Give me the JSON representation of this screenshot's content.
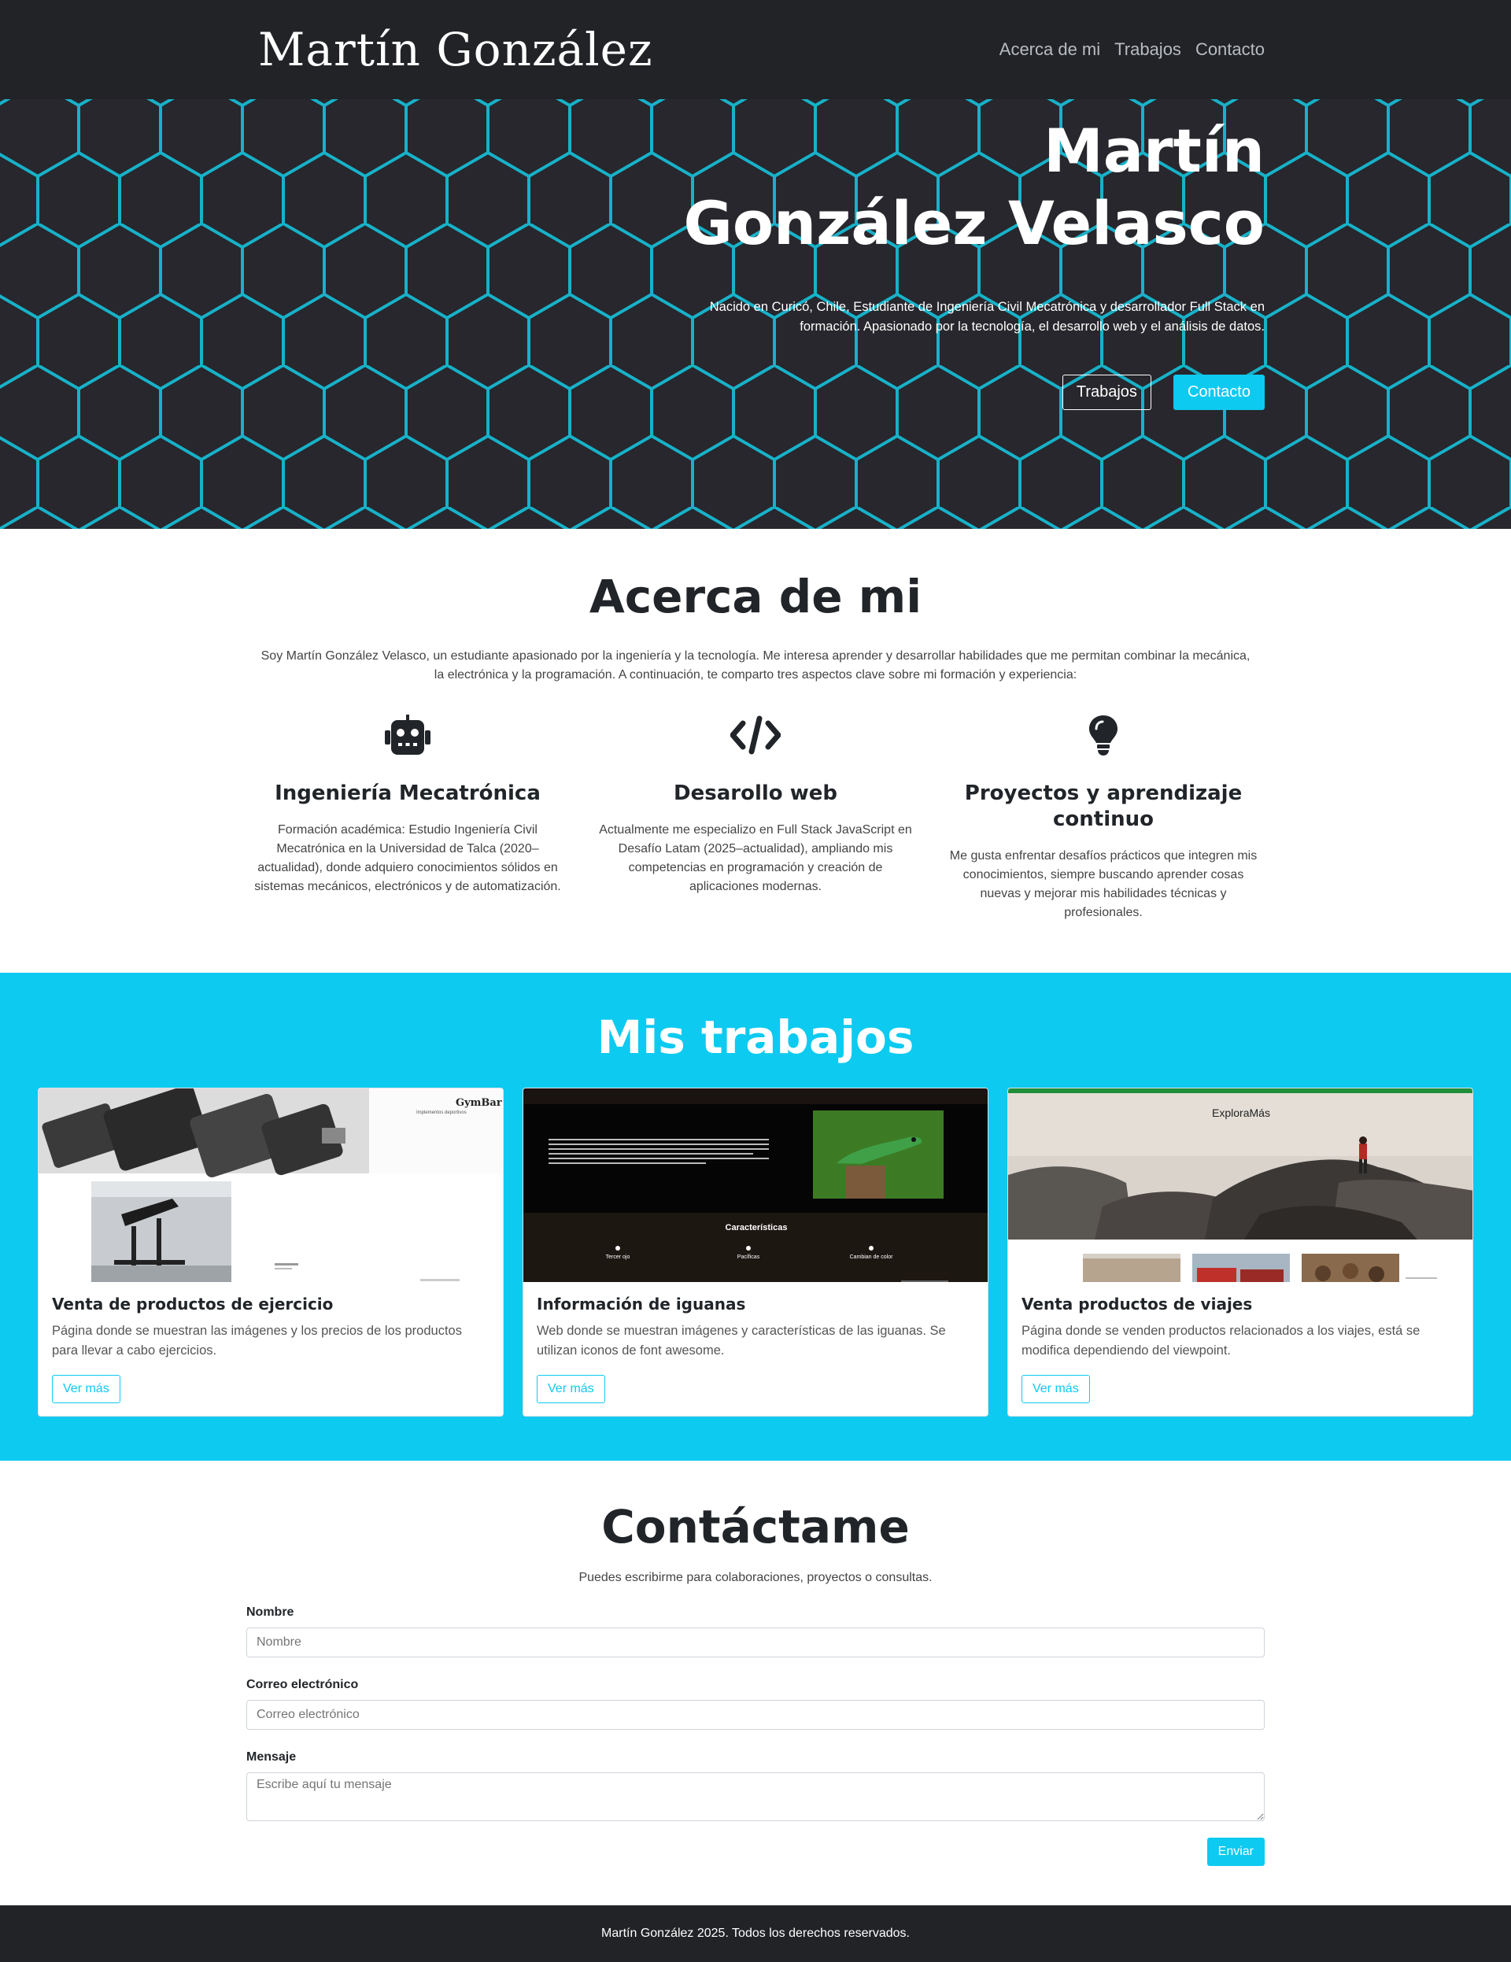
{
  "navbar": {
    "brand": "Martín  González",
    "links": [
      "Acerca de mi",
      "Trabajos",
      "Contacto"
    ]
  },
  "hero": {
    "title_line1": "Martín",
    "title_line2": "González Velasco",
    "description_line1": "Nacido en Curicó, Chile, Estudiante de Ingeniería Civil Mecatrónica y desarrollador Full Stack en",
    "description_line2": "formación. Apasionado por la tecnología, el desarrollo web y el análisis de datos.",
    "btn_works": "Trabajos",
    "btn_contact": "Contacto"
  },
  "about": {
    "title": "Acerca de mi",
    "intro_line1": "Soy Martín González Velasco, un estudiante apasionado por la ingeniería y la tecnología. Me interesa aprender y desarrollar habilidades que me permitan combinar la mecánica,",
    "intro_line2": "la electrónica y la programación. A continuación, te comparto tres aspectos clave sobre mi formación y experiencia:",
    "features": [
      {
        "icon": "robot-icon",
        "title": "Ingeniería Mecatrónica",
        "text": "Formación académica: Estudio Ingeniería Civil Mecatrónica en la Universidad de Talca (2020–actualidad), donde adquiero conocimientos sólidos en sistemas mecánicos, electrónicos y de automatización."
      },
      {
        "icon": "code-icon",
        "title": "Desarollo web",
        "text": "Actualmente me especializo en Full Stack JavaScript en Desafío Latam (2025–actualidad), ampliando mis competencias en programación y creación de aplicaciones modernas."
      },
      {
        "icon": "lightbulb-icon",
        "title": "Proyectos y aprendizaje continuo",
        "text": "Me gusta enfrentar desafíos prácticos que integren mis conocimientos, siempre buscando aprender cosas nuevas y mejorar mis habilidades técnicas y profesionales."
      }
    ]
  },
  "works": {
    "title": "Mis trabajos",
    "cards": [
      {
        "title": "Venta de productos de ejercicio",
        "text": "Página donde se muestran las imágenes y los precios de los productos para llevar a cabo ejercicios.",
        "button": "Ver más",
        "thumb_brand": "GymBar",
        "thumb_tagline": "Implementos deportivos"
      },
      {
        "title": "Información de iguanas",
        "text": "Web donde se muestran imágenes y características de las iguanas. Se utilizan iconos de font awesome.",
        "button": "Ver más",
        "thumb_heading": "Características",
        "thumb_items": [
          "Tercer ojo",
          "Pacíficas",
          "Cambian de color"
        ]
      },
      {
        "title": "Venta productos de viajes",
        "text": "Página donde se venden productos relacionados a los viajes, está se modifica dependiendo del viewpoint.",
        "button": "Ver más",
        "thumb_brand": "ExploraMás"
      }
    ]
  },
  "contact": {
    "title": "Contáctame",
    "subtitle": "Puedes escribirme para colaboraciones, proyectos o consultas.",
    "name_label": "Nombre",
    "name_placeholder": "Nombre",
    "email_label": "Correo electrónico",
    "email_placeholder": "Correo electrónico",
    "message_label": "Mensaje",
    "message_placeholder": "Escribe aquí tu mensaje",
    "send_button": "Enviar"
  },
  "footer": {
    "text": "Martín González 2025. Todos los derechos reservados."
  },
  "colors": {
    "accent": "#0dcaf0",
    "dark": "#222327",
    "hex_stroke": "#17b2c9"
  }
}
